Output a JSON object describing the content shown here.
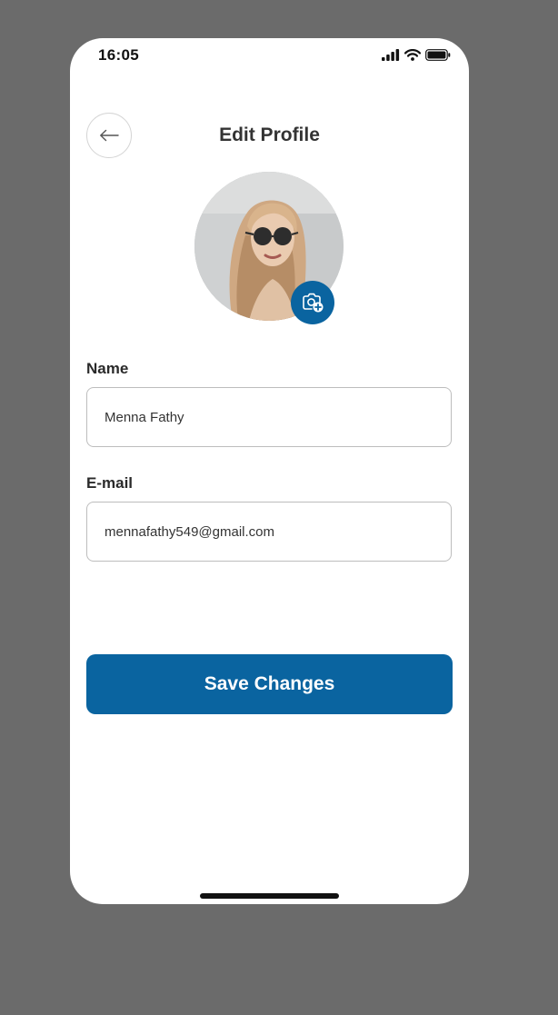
{
  "status_bar": {
    "time": "16:05",
    "icons": [
      "signal-icon",
      "wifi-icon",
      "battery-icon"
    ]
  },
  "header": {
    "back_icon": "arrow-left-icon",
    "title": "Edit Profile"
  },
  "profile": {
    "avatar": "profile-photo",
    "camera_icon": "camera-plus-icon"
  },
  "form": {
    "name": {
      "label": "Name",
      "value": "Menna Fathy"
    },
    "email": {
      "label": "E-mail",
      "value": "mennafathy549@gmail.com"
    }
  },
  "actions": {
    "save_label": "Save Changes"
  },
  "colors": {
    "backdrop": "#6b6b6b",
    "primary": "#0a64a0",
    "input_border": "#bdbdbd",
    "title_text": "#333333"
  }
}
